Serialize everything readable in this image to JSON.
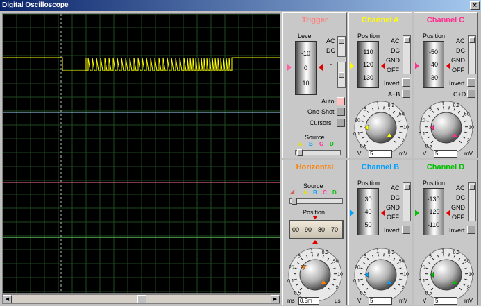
{
  "window": {
    "title": "Digital Oscilloscope",
    "close": "×"
  },
  "colors": {
    "A": "#ffff00",
    "B": "#00a0ff",
    "C": "#ff3090",
    "D": "#00c000",
    "trigger_title": "#ff8080",
    "horizontal_title": "#ff8000"
  },
  "trigger": {
    "title": "Trigger",
    "level_label": "Level",
    "drum": [
      "-10",
      "0",
      "10"
    ],
    "coupling": [
      "AC",
      "DC"
    ],
    "auto": "Auto",
    "oneshot": "One-Shot",
    "cursors": "Cursors",
    "source_label": "Source",
    "source_channels": [
      "A",
      "B",
      "C",
      "D"
    ]
  },
  "horizontal": {
    "title": "Horizontal",
    "source_label": "Source",
    "source_channels": [
      "A",
      "B",
      "C",
      "D"
    ],
    "position_label": "Position",
    "dial": [
      "00",
      "90",
      "80",
      "70"
    ],
    "units_left": "ms",
    "units_right": "µs",
    "value": "0.5m",
    "scale": [
      "0.5",
      "0.2",
      "0.1",
      "50",
      "20",
      "10",
      "5",
      "2",
      "1",
      "0.5",
      "0.2",
      "0.1",
      "50",
      "20",
      "10",
      "5",
      "2",
      "1"
    ]
  },
  "channels": {
    "A": {
      "title": "Channel A",
      "position_label": "Position",
      "drum": [
        "110",
        "120",
        "130"
      ],
      "coupling": [
        "AC",
        "DC",
        "GND",
        "OFF"
      ],
      "invert": "Invert",
      "math": "A+B",
      "value": "5",
      "unit_left": "V",
      "unit_right": "mV"
    },
    "C": {
      "title": "Channel C",
      "position_label": "Position",
      "drum": [
        "-50",
        "-40",
        "-30"
      ],
      "coupling": [
        "AC",
        "DC",
        "GND",
        "OFF"
      ],
      "invert": "Invert",
      "math": "C+D",
      "value": "5",
      "unit_left": "V",
      "unit_right": "mV"
    },
    "B": {
      "title": "Channel B",
      "position_label": "Position",
      "drum": [
        "30",
        "40",
        "50"
      ],
      "coupling": [
        "AC",
        "DC",
        "GND",
        "OFF"
      ],
      "invert": "Invert",
      "value": "5",
      "unit_left": "V",
      "unit_right": "mV"
    },
    "D": {
      "title": "Channel D",
      "position_label": "Position",
      "drum": [
        "-130",
        "-120",
        "-110"
      ],
      "coupling": [
        "AC",
        "DC",
        "GND",
        "OFF"
      ],
      "invert": "Invert",
      "value": "5",
      "unit_left": "V",
      "unit_right": "mV"
    }
  },
  "volt_scale": [
    "0.5",
    "0.2",
    "0.1",
    "50",
    "20",
    "10",
    "5",
    "2",
    "1",
    "0.5",
    "0.2",
    "0.1",
    "50",
    "20",
    "10",
    "5",
    "2",
    "1"
  ]
}
